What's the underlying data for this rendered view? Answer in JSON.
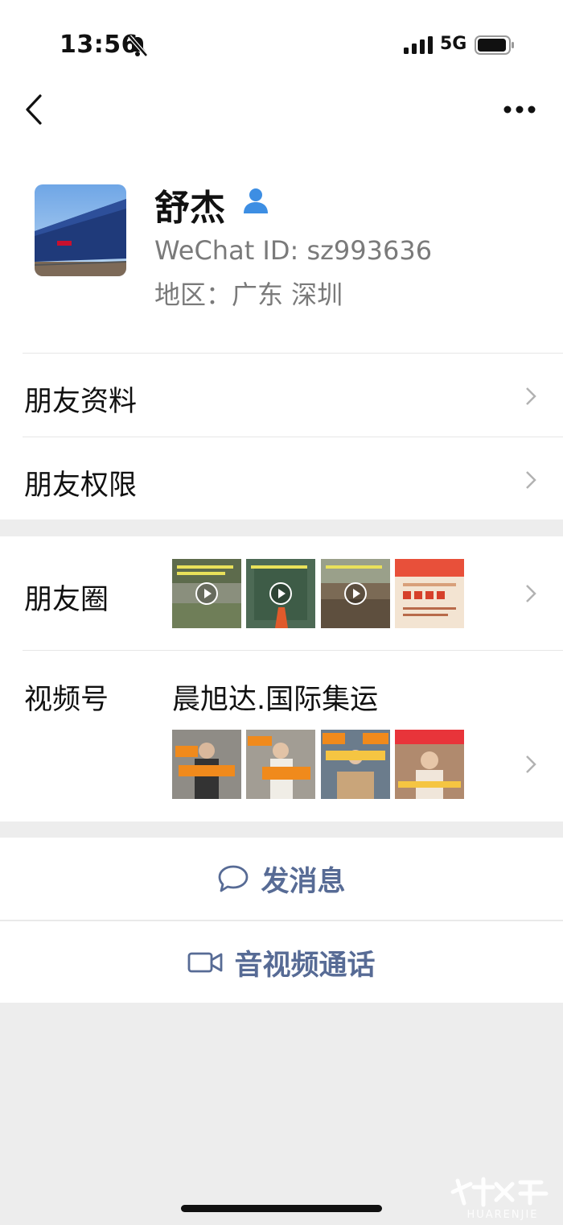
{
  "status_bar": {
    "time": "13:56",
    "network": "5G"
  },
  "profile": {
    "name": "舒杰",
    "wechat_id": "WeChat ID: sz993636",
    "region": "地区：广东 深圳"
  },
  "menu": {
    "friend_info": "朋友资料",
    "friend_permissions": "朋友权限",
    "moments": "朋友圈",
    "channels": "视频号",
    "channel_name": "晨旭达.国际集运"
  },
  "actions": {
    "send_message": "发消息",
    "video_call": "音视频通话"
  },
  "watermark": {
    "text": "HUARENJIE"
  },
  "colors": {
    "link": "#576b95",
    "background": "#ededed",
    "card": "#ffffff"
  }
}
